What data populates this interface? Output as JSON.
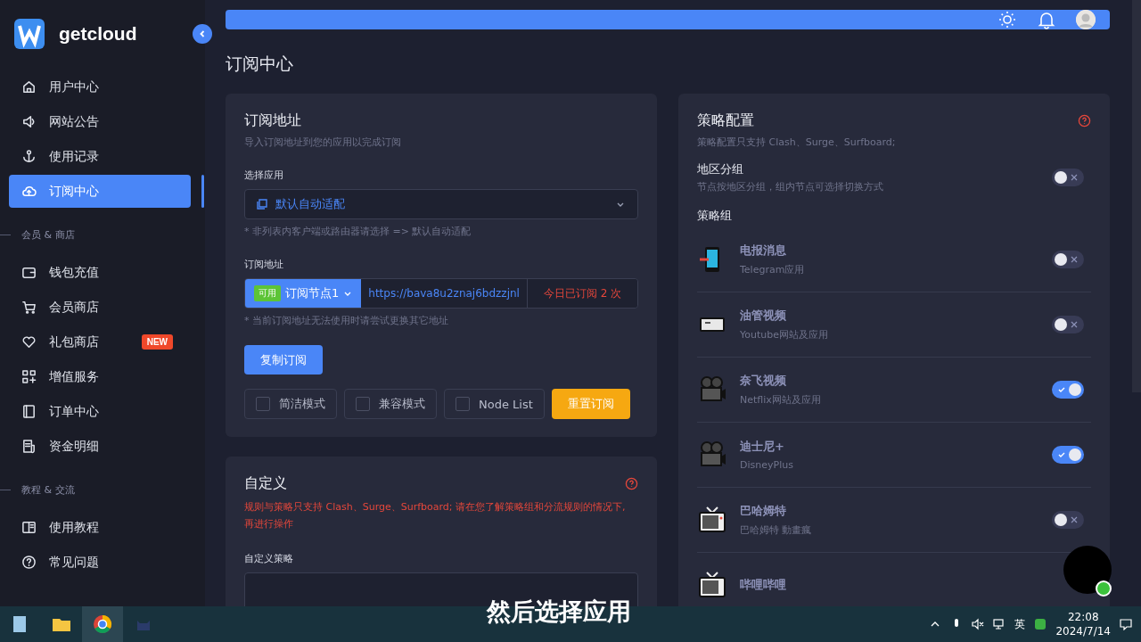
{
  "sidebar": {
    "logo_text": "getcloud",
    "sections": [
      {
        "items": [
          {
            "label": "用户中心",
            "selected": false
          },
          {
            "label": "网站公告",
            "selected": false
          },
          {
            "label": "使用记录",
            "selected": false
          },
          {
            "label": "订阅中心",
            "selected": true
          }
        ]
      },
      {
        "heading": "会员 & 商店",
        "items": [
          {
            "label": "钱包充值",
            "selected": false
          },
          {
            "label": "会员商店",
            "selected": false
          },
          {
            "label": "礼包商店",
            "selected": false,
            "badge": "NEW"
          },
          {
            "label": "增值服务",
            "selected": false
          },
          {
            "label": "订单中心",
            "selected": false
          },
          {
            "label": "资金明细",
            "selected": false
          }
        ]
      },
      {
        "heading": "教程 & 交流",
        "items": [
          {
            "label": "使用教程",
            "selected": false
          },
          {
            "label": "常见问题",
            "selected": false
          }
        ]
      }
    ]
  },
  "page_title": "订阅中心",
  "subscription_card": {
    "title": "订阅地址",
    "subtitle": "导入订阅地址到您的应用以完成订阅",
    "app_label": "选择应用",
    "app_select": {
      "value": "默认自动适配"
    },
    "app_hint": "* 非列表内客户端或路由器请选择 => 默认自动适配",
    "url_label": "订阅地址",
    "node_status": "可用",
    "node_select": "订阅节点1",
    "url": "https://bava8u2znaj6bdzzjnl",
    "today_count": "今日已订阅 2 次",
    "url_hint": "* 当前订阅地址无法使用时请尝试更换其它地址",
    "copy_button": "复制订阅",
    "options": [
      {
        "label": "简洁模式",
        "checked": false
      },
      {
        "label": "兼容模式",
        "checked": false
      },
      {
        "label": "Node List",
        "checked": false
      }
    ],
    "reset_button": "重置订阅"
  },
  "custom_card": {
    "title": "自定义",
    "warning": "规则与策略只支持 Clash、Surge、Surfboard; 请在您了解策略组和分流规则的情况下, 再进行操作",
    "policy_label": "自定义策略"
  },
  "strategy_card": {
    "title": "策略配置",
    "subtitle": "策略配置只支持 Clash、Surge、Surfboard;",
    "region_group": {
      "title": "地区分组",
      "description": "节点按地区分组，组内节点可选择切换方式",
      "on": false
    },
    "groups_heading": "策略组",
    "groups": [
      {
        "name": "电报消息",
        "description": "Telegram应用",
        "on": false
      },
      {
        "name": "油管视频",
        "description": "Youtube网站及应用",
        "on": false
      },
      {
        "name": "奈飞视频",
        "description": "Netflix网站及应用",
        "on": true
      },
      {
        "name": "迪士尼+",
        "description": "DisneyPlus",
        "on": true
      },
      {
        "name": "巴哈姆特",
        "description": "巴哈姆特 動畫瘋",
        "on": false
      },
      {
        "name": "哔哩哔哩"
      }
    ]
  },
  "taskbar": {
    "input_method": "英",
    "time": "22:08",
    "date": "2024/7/14"
  },
  "subtitle": "然后选择应用"
}
